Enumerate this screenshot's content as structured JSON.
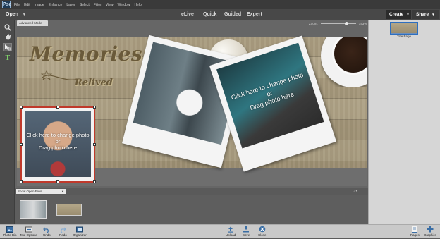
{
  "menubar": {
    "app_icon": "Pse",
    "items": [
      "File",
      "Edit",
      "Image",
      "Enhance",
      "Layer",
      "Select",
      "Filter",
      "View",
      "Window",
      "Help"
    ]
  },
  "modebar": {
    "open_label": "Open",
    "tabs": [
      "eLive",
      "Quick",
      "Guided",
      "Expert"
    ],
    "create_label": "Create",
    "share_label": "Share"
  },
  "document": {
    "tab_label": "Advanced Mode",
    "zoom_label": "Zoom:",
    "zoom_value": "143%",
    "zoom_level_percent": 143
  },
  "canvas": {
    "title": "Memories",
    "subtitle": "Relived",
    "photo_prompt": [
      "Click here to change photo",
      "or",
      "Drag photo here"
    ]
  },
  "bin": {
    "select_value": "Show Open Files",
    "count_icon_text": "□ ▾"
  },
  "right_panel": {
    "page_label": "Title Page"
  },
  "taskbar": {
    "left": [
      "Photo Bin",
      "Tool Options",
      "Undo",
      "Redo",
      "Organizer"
    ],
    "center": [
      "Upload",
      "Save",
      "Close"
    ],
    "right": [
      "Pages",
      "Graphics"
    ]
  },
  "colors": {
    "selection": "#c0392b",
    "accent_blue": "#2f6fbf"
  }
}
